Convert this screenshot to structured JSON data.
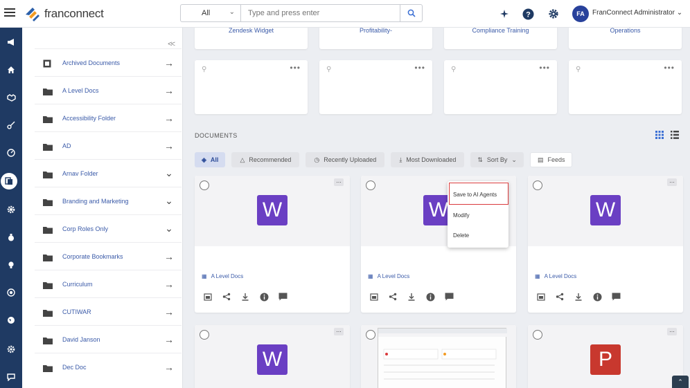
{
  "app": {
    "brand": "franconnect"
  },
  "search": {
    "scope": "All",
    "placeholder": "Type and press enter"
  },
  "user": {
    "initials": "FA",
    "name": "FranConnect Administrator"
  },
  "colors": {
    "rail": "#1f3a63",
    "accent": "#3a5aa8",
    "word": "#6a3fc3",
    "ppt": "#c8382e",
    "highlight": "#d9393b"
  },
  "rail_icons": [
    "megaphone-icon",
    "home-icon",
    "handshake-icon",
    "key-icon",
    "gauge-icon",
    "documents-icon",
    "gear-icon",
    "bag-icon",
    "bulb-icon",
    "globe-icon",
    "globe-alt-icon",
    "settings-icon",
    "chat-icon"
  ],
  "folders": {
    "collapse_label": "<<",
    "items": [
      {
        "label": "Archived Documents",
        "icon": "archive-icon",
        "control": "arrow"
      },
      {
        "label": "A Level Docs",
        "icon": "folder-icon",
        "control": "arrow"
      },
      {
        "label": "Accessibility Folder",
        "icon": "folder-icon",
        "control": "arrow"
      },
      {
        "label": "AD",
        "icon": "folder-icon",
        "control": "arrow"
      },
      {
        "label": "Arnav Folder",
        "icon": "folder-icon",
        "control": "chevron"
      },
      {
        "label": "Branding and Marketing",
        "icon": "folder-icon",
        "control": "chevron"
      },
      {
        "label": "Corp Roles Only",
        "icon": "folder-icon",
        "control": "chevron"
      },
      {
        "label": "Corporate Bookmarks",
        "icon": "folder-icon",
        "control": "arrow"
      },
      {
        "label": "Curriculum",
        "icon": "folder-icon",
        "control": "arrow"
      },
      {
        "label": "CUTIWAR",
        "icon": "folder-icon",
        "control": "arrow"
      },
      {
        "label": "David Janson",
        "icon": "folder-icon",
        "control": "arrow"
      },
      {
        "label": "Dec Doc",
        "icon": "folder-icon",
        "control": "arrow"
      }
    ]
  },
  "top_cards": [
    "Zendesk Widget",
    "Profitability-",
    "Compliance Training",
    "Operations"
  ],
  "documents": {
    "title": "DOCUMENTS",
    "filters": [
      {
        "label": "All",
        "icon": "layers-icon",
        "active": true
      },
      {
        "label": "Recommended",
        "icon": "thumbs-up-icon",
        "active": false
      },
      {
        "label": "Recently Uploaded",
        "icon": "clock-icon",
        "active": false
      },
      {
        "label": "Most Downloaded",
        "icon": "download-icon",
        "active": false
      },
      {
        "label": "Sort By",
        "icon": "sort-icon",
        "active": false
      },
      {
        "label": "Feeds",
        "icon": "feed-icon",
        "active": false
      }
    ],
    "cards": [
      {
        "type": "W",
        "folder": "A Level Docs"
      },
      {
        "type": "W",
        "folder": "A Level Docs"
      },
      {
        "type": "W",
        "folder": "A Level Docs"
      },
      {
        "type": "W",
        "folder": ""
      },
      {
        "type": "",
        "folder": ""
      },
      {
        "type": "P",
        "folder": ""
      }
    ]
  },
  "context_menu": {
    "items": [
      "Save to AI Agents",
      "Modify",
      "Delete"
    ],
    "highlighted": "Save to AI Agents"
  }
}
